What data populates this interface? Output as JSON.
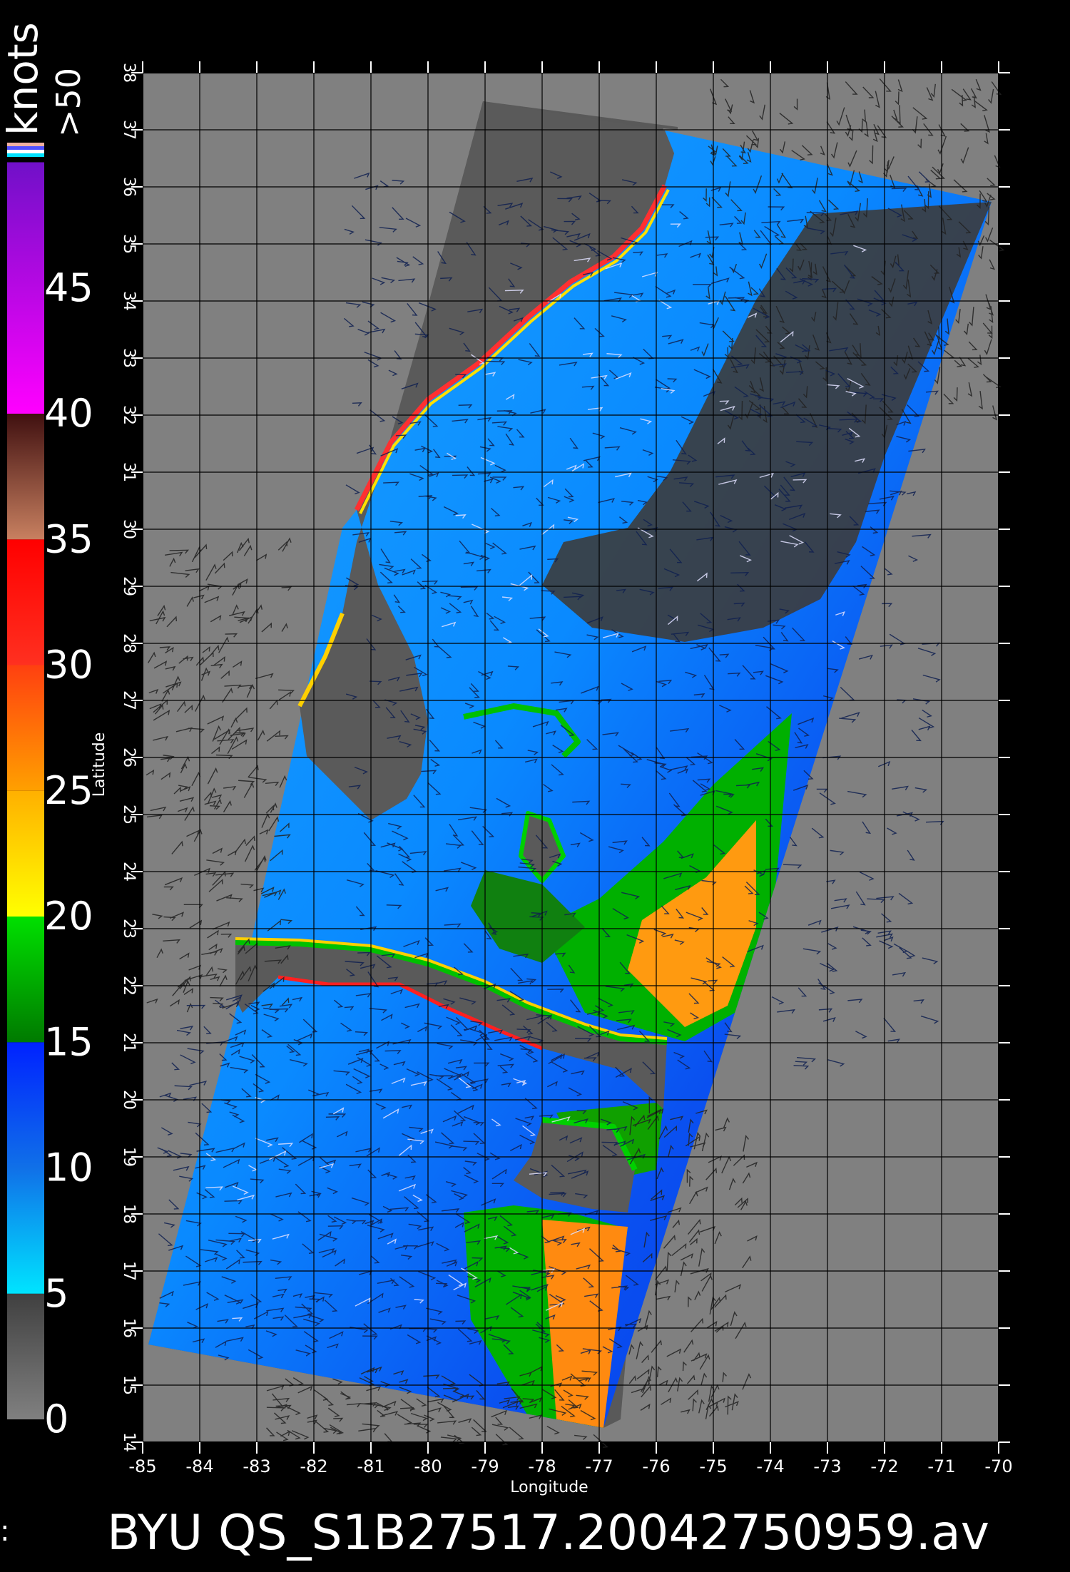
{
  "legend": {
    "unit": "knots",
    "top_label": ">50",
    "labels": [
      "0",
      "5",
      "10",
      "15",
      "20",
      "25",
      "30",
      "35",
      "40",
      "45"
    ],
    "segments": [
      {
        "from": 0,
        "to": 5,
        "colors": [
          "#808080",
          "#404040"
        ]
      },
      {
        "from": 5,
        "to": 10,
        "colors": [
          "#00e4ff",
          "#1070e8"
        ]
      },
      {
        "from": 10,
        "to": 15,
        "colors": [
          "#1070e8",
          "#0022ff"
        ]
      },
      {
        "from": 15,
        "to": 20,
        "colors": [
          "#007a00",
          "#00e000"
        ]
      },
      {
        "from": 20,
        "to": 25,
        "colors": [
          "#ffff00",
          "#ffb000"
        ]
      },
      {
        "from": 25,
        "to": 30,
        "colors": [
          "#ffa000",
          "#ff4010"
        ]
      },
      {
        "from": 30,
        "to": 35,
        "colors": [
          "#ff3020",
          "#ff0000"
        ]
      },
      {
        "from": 35,
        "to": 40,
        "colors": [
          "#c88060",
          "#401010"
        ]
      },
      {
        "from": 40,
        "to": 50,
        "colors": [
          "#ff00ff",
          "#7010c8"
        ]
      }
    ],
    "top_swatches": [
      "#f0b0a0",
      "#5050ff",
      "#ffffff",
      "#00e0ff"
    ]
  },
  "map": {
    "lon_ticks": [
      "-85",
      "-84",
      "-83",
      "-82",
      "-81",
      "-80",
      "-79",
      "-78",
      "-77",
      "-76",
      "-75",
      "-74",
      "-73",
      "-72",
      "-71",
      "-70"
    ],
    "lat_ticks": [
      "14",
      "15",
      "16",
      "17",
      "18",
      "19",
      "20",
      "21",
      "22",
      "23",
      "24",
      "25",
      "26",
      "27",
      "28",
      "29",
      "30",
      "31",
      "32",
      "33",
      "34",
      "35",
      "36",
      "37",
      "38"
    ],
    "x_axis_label": "Longitude",
    "y_axis_label": "Latitude",
    "colors": {
      "background": "#808080",
      "swath_nodata": "#595959",
      "land": "#5a5a5a",
      "grid": "#000000"
    }
  },
  "footer": {
    "title": "BYU  QS_S1B27517.20042750959.av",
    "left_glyph": ":"
  }
}
